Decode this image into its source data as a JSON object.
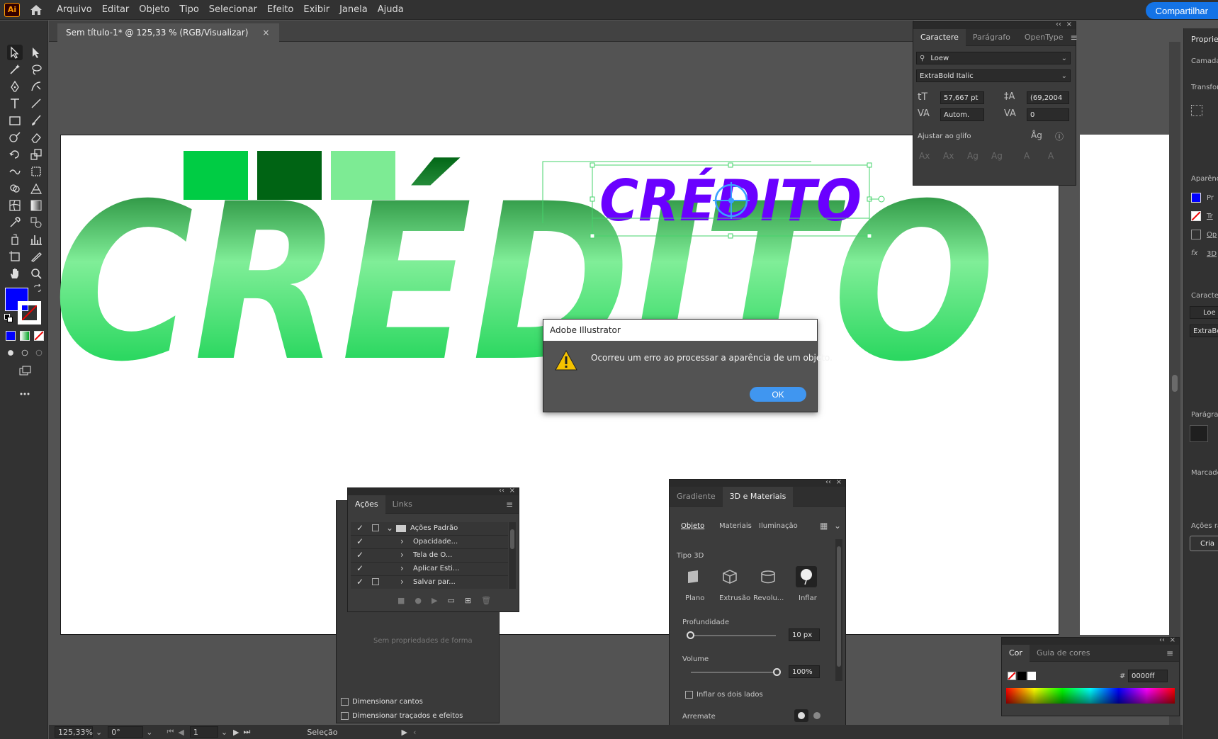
{
  "app": {
    "logo": "Ai",
    "share_label": "Compartilhar"
  },
  "menu": [
    "Arquivo",
    "Editar",
    "Objeto",
    "Tipo",
    "Selecionar",
    "Efeito",
    "Exibir",
    "Janela",
    "Ajuda"
  ],
  "document": {
    "tab_title": "Sem título-1* @ 125,33 % (RGB/Visualizar)",
    "close_glyph": "×"
  },
  "colors": {
    "swatch1": "#00cc44",
    "swatch2": "#006414",
    "swatch3": "#7deb94",
    "fill": "#0000ff",
    "small_text": "#6a00ff",
    "accent": "#1473e6"
  },
  "artwork": {
    "big_text": "CRÉDITO",
    "small_text": "CRÉDITO"
  },
  "dialog": {
    "title": "Adobe Illustrator",
    "message": "Ocorreu um erro ao processar a aparência de um objeto.",
    "ok_label": "OK"
  },
  "character_panel": {
    "tabs": [
      "Caractere",
      "Parágrafo",
      "OpenType"
    ],
    "font_family": "Loew",
    "font_style": "ExtraBold Italic",
    "font_size": "57,667 pt",
    "leading": "(69,2004",
    "kerning": "Autom.",
    "tracking": "0",
    "snap_label": "Ajustar ao glifo"
  },
  "actions_panel": {
    "tabs": [
      "Ações",
      "Links"
    ],
    "items": [
      {
        "label": "Ações Padrão",
        "type": "set"
      },
      {
        "label": "Opacidade...",
        "type": "action"
      },
      {
        "label": "Tela de O...",
        "type": "action"
      },
      {
        "label": "Aplicar Esti...",
        "type": "action"
      },
      {
        "label": "Salvar par...",
        "type": "action"
      }
    ]
  },
  "under_actions": {
    "no_props": "Sem propriedades de forma",
    "chk_corners": "Dimensionar cantos",
    "chk_strokes": "Dimensionar traçados e efeitos"
  },
  "threed_panel": {
    "tabs": [
      "Gradiente",
      "3D e Materiais"
    ],
    "subtabs": [
      "Objeto",
      "Materiais",
      "Iluminação"
    ],
    "type_label": "Tipo 3D",
    "types": [
      "Plano",
      "Extrusão",
      "Revolu...",
      "Inflar"
    ],
    "depth_label": "Profundidade",
    "depth_value": "10 px",
    "volume_label": "Volume",
    "volume_value": "100%",
    "inflate_both": "Inflar os dois lados",
    "bevel_label": "Arremate"
  },
  "color_panel": {
    "tabs": [
      "Cor",
      "Guia de cores"
    ],
    "hex_prefix": "#",
    "hex_value": "0000ff"
  },
  "properties": {
    "title": "Propried",
    "labels": [
      "Camada",
      "Transform",
      "Aparência",
      "Pr",
      "Tr",
      "Op",
      "3D",
      "Caractere",
      "Loe",
      "ExtraBo",
      "Parágrafo",
      "Marcador",
      "Ações ráp",
      "Cria"
    ]
  },
  "status": {
    "zoom": "125,33%",
    "angle": "0°",
    "artboard": "1",
    "tool": "Seleção"
  }
}
